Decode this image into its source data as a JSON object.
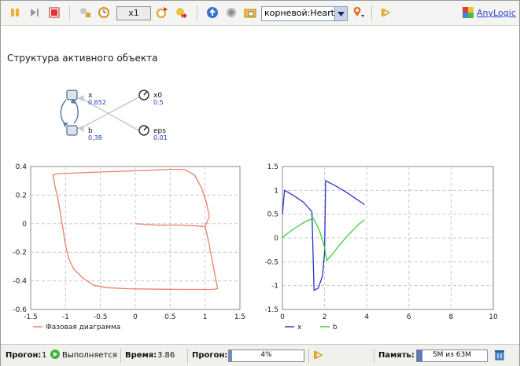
{
  "toolbar": {
    "speed": "x1",
    "root_selector": "корневой:Heart",
    "logo": "AnyLogic"
  },
  "structure": {
    "title": "Структура активного объекта",
    "variables": [
      {
        "name": "x",
        "value": "0.652"
      },
      {
        "name": "b",
        "value": "0.38"
      }
    ],
    "parameters": [
      {
        "name": "x0",
        "value": "0.5"
      },
      {
        "name": "eps",
        "value": "0.01"
      }
    ]
  },
  "chart_data": [
    {
      "type": "line",
      "xlim": [
        -1.5,
        1.5
      ],
      "ylim": [
        -0.6,
        0.4
      ],
      "x_ticks": [
        "-1.5",
        "-1",
        "-0.5",
        "0",
        "0.5",
        "1",
        "1.5"
      ],
      "y_ticks": [
        "0.4",
        "0.2",
        "0",
        "-0.2",
        "-0.4",
        "-0.6"
      ],
      "grid": true,
      "legend_position": "bottom",
      "series": [
        {
          "name": "Фазовая диаграмма",
          "color": "#e8806a",
          "points": [
            [
              0.0,
              0.0
            ],
            [
              0.3,
              -0.01
            ],
            [
              0.6,
              -0.01
            ],
            [
              0.85,
              -0.015
            ],
            [
              1.0,
              -0.02
            ],
            [
              1.04,
              -0.1
            ],
            [
              1.08,
              -0.2
            ],
            [
              1.12,
              -0.3
            ],
            [
              1.15,
              -0.38
            ],
            [
              1.18,
              -0.455
            ],
            [
              1.1,
              -0.46
            ],
            [
              0.7,
              -0.46
            ],
            [
              0.3,
              -0.458
            ],
            [
              -0.1,
              -0.455
            ],
            [
              -0.4,
              -0.448
            ],
            [
              -0.6,
              -0.43
            ],
            [
              -0.75,
              -0.38
            ],
            [
              -0.88,
              -0.32
            ],
            [
              -0.95,
              -0.25
            ],
            [
              -1.0,
              -0.15
            ],
            [
              -1.05,
              0.0
            ],
            [
              -1.1,
              0.15
            ],
            [
              -1.15,
              0.26
            ],
            [
              -1.18,
              0.34
            ],
            [
              -1.1,
              0.35
            ],
            [
              -0.6,
              0.36
            ],
            [
              0.0,
              0.37
            ],
            [
              0.5,
              0.38
            ],
            [
              0.7,
              0.38
            ],
            [
              0.85,
              0.34
            ],
            [
              0.95,
              0.25
            ],
            [
              1.02,
              0.15
            ],
            [
              1.06,
              0.05
            ],
            [
              1.0,
              -0.02
            ]
          ]
        }
      ]
    },
    {
      "type": "line",
      "xlim": [
        0,
        10
      ],
      "ylim": [
        -1.5,
        1.5
      ],
      "x_ticks": [
        "0",
        "2",
        "4",
        "6",
        "8",
        "10"
      ],
      "y_ticks": [
        "1.5",
        "1",
        "0.5",
        "0",
        "-0.5",
        "-1",
        "-1.5"
      ],
      "grid": true,
      "legend_position": "bottom",
      "series": [
        {
          "name": "x",
          "color": "#2a36c8",
          "points": [
            [
              0.0,
              0.5
            ],
            [
              0.1,
              1.0
            ],
            [
              0.5,
              0.9
            ],
            [
              1.0,
              0.75
            ],
            [
              1.4,
              0.55
            ],
            [
              1.45,
              -0.3
            ],
            [
              1.5,
              -1.1
            ],
            [
              1.7,
              -1.05
            ],
            [
              1.9,
              -0.8
            ],
            [
              2.0,
              -0.3
            ],
            [
              2.05,
              1.2
            ],
            [
              2.5,
              1.1
            ],
            [
              3.0,
              0.97
            ],
            [
              3.5,
              0.82
            ],
            [
              3.9,
              0.7
            ]
          ]
        },
        {
          "name": "b",
          "color": "#3ad03a",
          "points": [
            [
              0.0,
              0.0
            ],
            [
              0.1,
              0.05
            ],
            [
              0.5,
              0.18
            ],
            [
              1.0,
              0.32
            ],
            [
              1.3,
              0.38
            ],
            [
              1.45,
              0.42
            ],
            [
              1.6,
              0.3
            ],
            [
              1.8,
              0.1
            ],
            [
              2.0,
              -0.2
            ],
            [
              2.1,
              -0.47
            ],
            [
              2.3,
              -0.38
            ],
            [
              2.7,
              -0.15
            ],
            [
              3.2,
              0.1
            ],
            [
              3.6,
              0.28
            ],
            [
              3.9,
              0.38
            ]
          ]
        }
      ]
    }
  ],
  "status": {
    "run_label": "Прогон:",
    "run_value": "1",
    "state": "Выполняется",
    "time_label": "Время:",
    "time_value": "3.86",
    "progress_label": "Прогон:",
    "progress_value": "4%",
    "progress_fraction": 0.04,
    "memory_label": "Память:",
    "memory_value": "5M из 63M",
    "memory_fraction": 0.08
  },
  "colors": {
    "accent": "#2a3fd0",
    "chart_line": "#e8806a",
    "grid": "#c8c8c8"
  }
}
